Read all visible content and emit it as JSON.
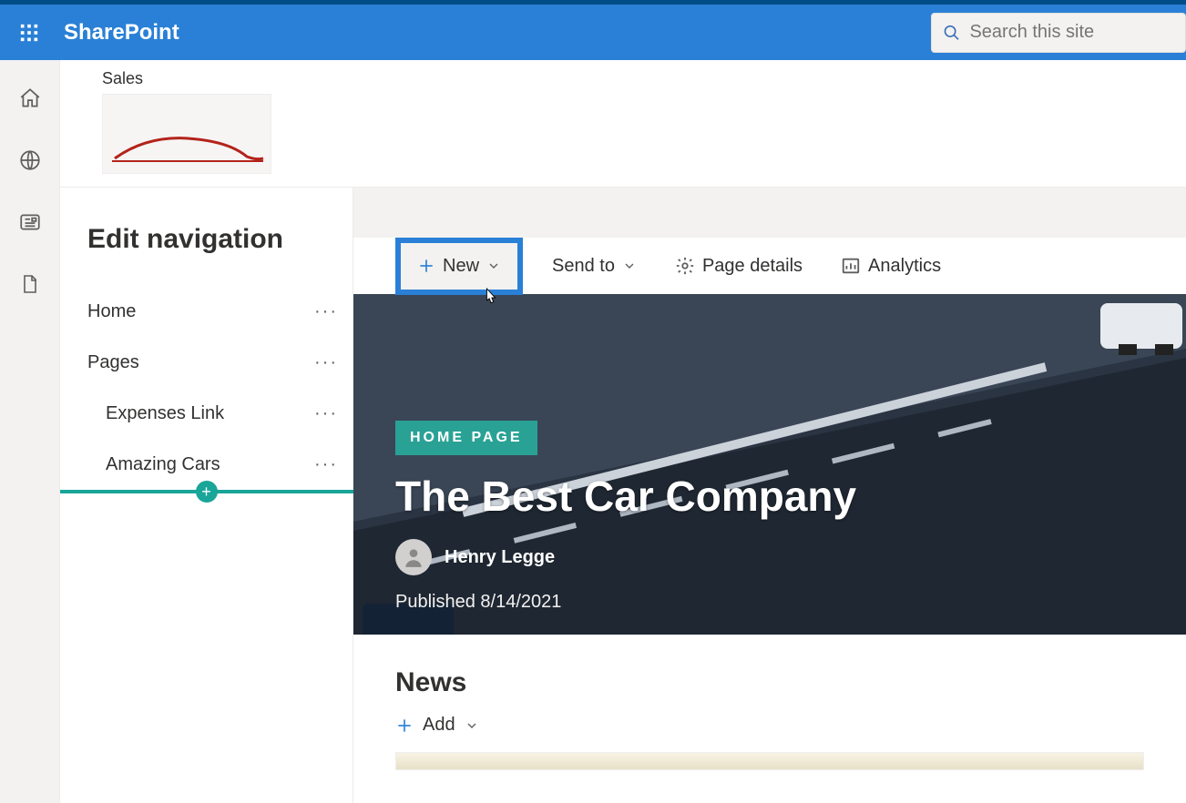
{
  "header": {
    "brand": "SharePoint",
    "search_placeholder": "Search this site"
  },
  "site": {
    "parent": "Sales"
  },
  "nav": {
    "title": "Edit navigation",
    "items": [
      {
        "label": "Home",
        "indent": false
      },
      {
        "label": "Pages",
        "indent": false
      },
      {
        "label": "Expenses Link",
        "indent": true
      },
      {
        "label": "Amazing Cars",
        "indent": true
      }
    ]
  },
  "cmdbar": {
    "new": "New",
    "send_to": "Send to",
    "page_details": "Page details",
    "analytics": "Analytics"
  },
  "hero": {
    "badge": "HOME PAGE",
    "title": "The Best Car Company",
    "author": "Henry Legge",
    "published_label": "Published 8/14/2021"
  },
  "news": {
    "title": "News",
    "add": "Add"
  }
}
